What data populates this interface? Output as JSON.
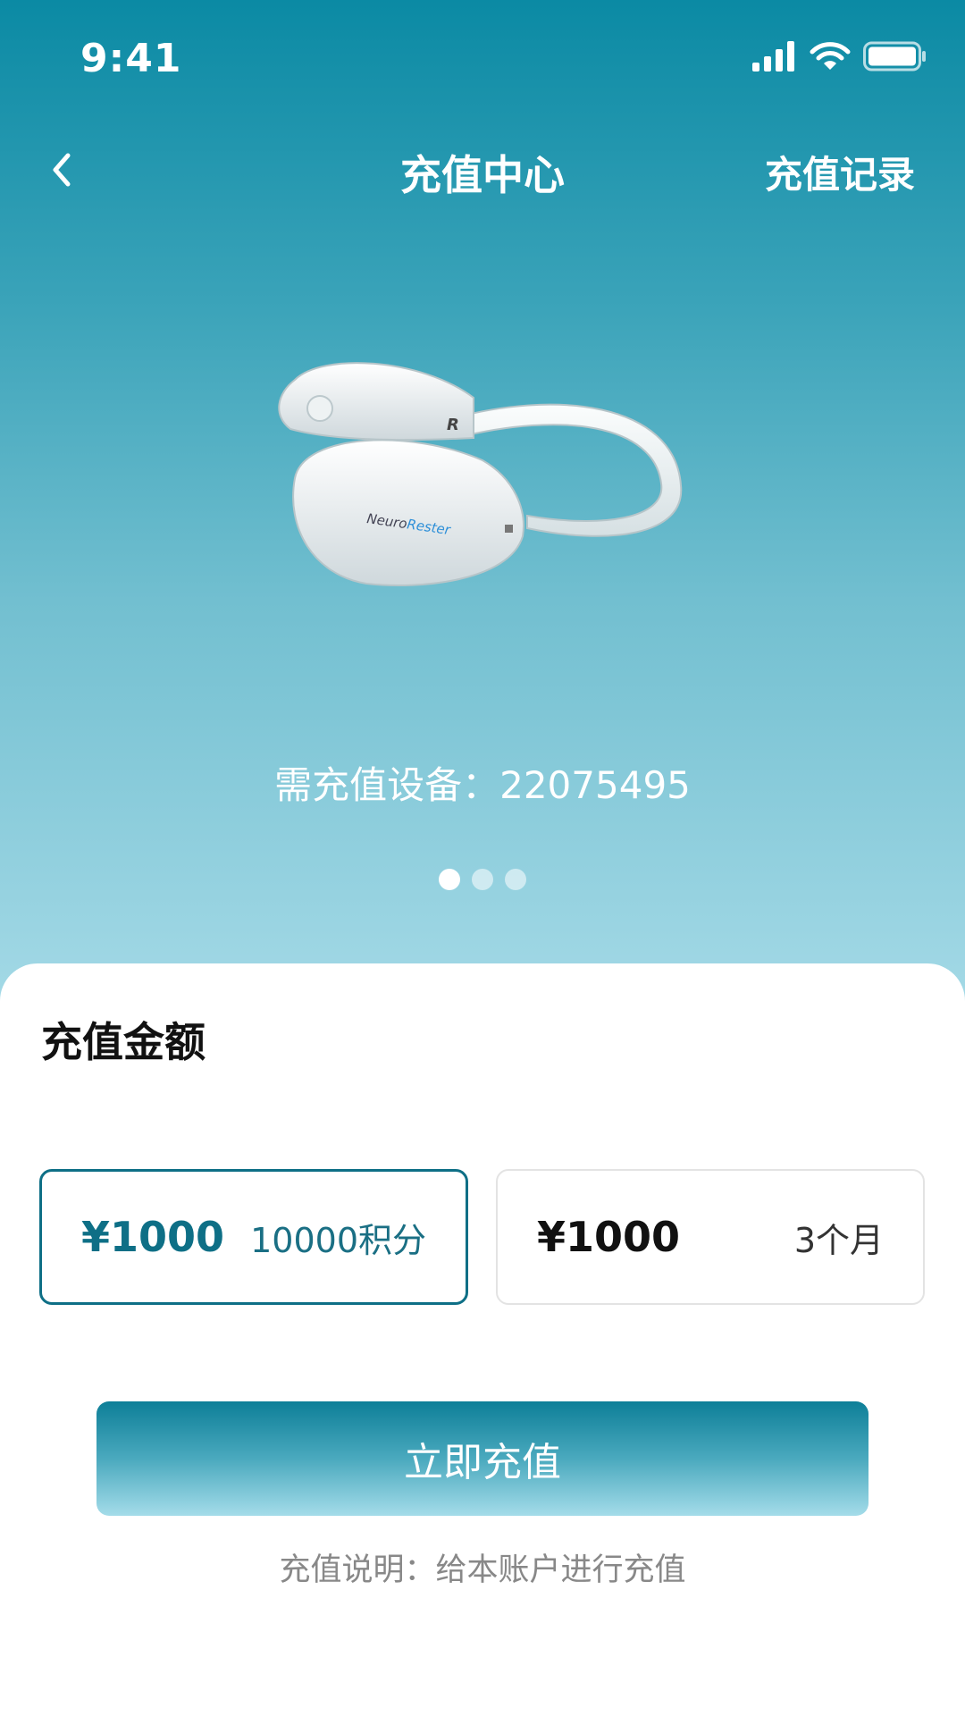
{
  "status_bar": {
    "time": "9:41"
  },
  "nav": {
    "title": "充值中心",
    "record_label": "充值记录"
  },
  "device": {
    "brand_text_1": "Neuro",
    "brand_text_2": "Rester",
    "side_mark": "R",
    "label": "需充值设备：22075495"
  },
  "carousel": {
    "page_count": 3,
    "active_index": 0
  },
  "section": {
    "title": "充值金额"
  },
  "options": [
    {
      "price": "¥1000",
      "desc": "10000积分",
      "selected": true
    },
    {
      "price": "¥1000",
      "desc": "3个月",
      "selected": false
    }
  ],
  "action": {
    "button_label": "立即充值",
    "note": "充值说明：给本账户进行充值"
  },
  "colors": {
    "accent": "#0e6f86",
    "hero_top": "#0b8aa4",
    "hero_bottom": "#a3d9e6"
  }
}
